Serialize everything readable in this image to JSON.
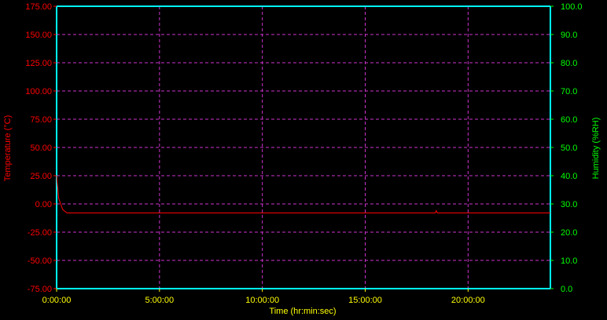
{
  "chart_data": {
    "type": "line",
    "xlabel": "Time (hr:min:sec)",
    "ylabel_left": "Temperature (°C)",
    "ylabel_right": "Humidity (%RH)",
    "x_unit": "hours",
    "xlim": [
      0,
      24
    ],
    "x_ticks": [
      0,
      5,
      10,
      15,
      20
    ],
    "x_tick_labels": [
      "0:00:00",
      "5:00:00",
      "10:00:00",
      "15:00:00",
      "20:00:00"
    ],
    "ylim_left": [
      -75,
      175
    ],
    "y_left_ticks": [
      175,
      150,
      125,
      100,
      75,
      50,
      25,
      0,
      -25,
      -50,
      -75
    ],
    "y_left_tick_labels": [
      "175.00",
      "150.00",
      "125.00",
      "100.00",
      "75.00",
      "50.00",
      "25.00",
      "0.00",
      "-25.00",
      "-50.00",
      "-75.00"
    ],
    "ylim_right": [
      0,
      100
    ],
    "y_right_ticks": [
      100,
      90,
      80,
      70,
      60,
      50,
      40,
      30,
      20,
      10,
      0
    ],
    "y_right_tick_labels": [
      "100.0",
      "90.0",
      "80.0",
      "70.0",
      "60.0",
      "50.0",
      "40.0",
      "30.0",
      "20.0",
      "10.0",
      "0.0"
    ],
    "grid": true,
    "series": [
      {
        "axis": "left",
        "color": "#ff0000",
        "x": [
          0,
          0.05,
          0.1,
          0.2,
          0.3,
          0.5,
          1,
          5,
          10,
          15,
          18.4,
          18.45,
          18.5,
          20,
          24
        ],
        "y": [
          25,
          15,
          5,
          0,
          -5,
          -8,
          -8,
          -8,
          -8,
          -8,
          -8,
          -6,
          -8,
          -8,
          -8
        ]
      }
    ],
    "colors": {
      "background": "#000000",
      "frame": "#00ffff",
      "grid": "#cc33cc",
      "left_axis": "#ff0000",
      "right_axis": "#00ff00",
      "x_axis": "#ffff00"
    }
  }
}
